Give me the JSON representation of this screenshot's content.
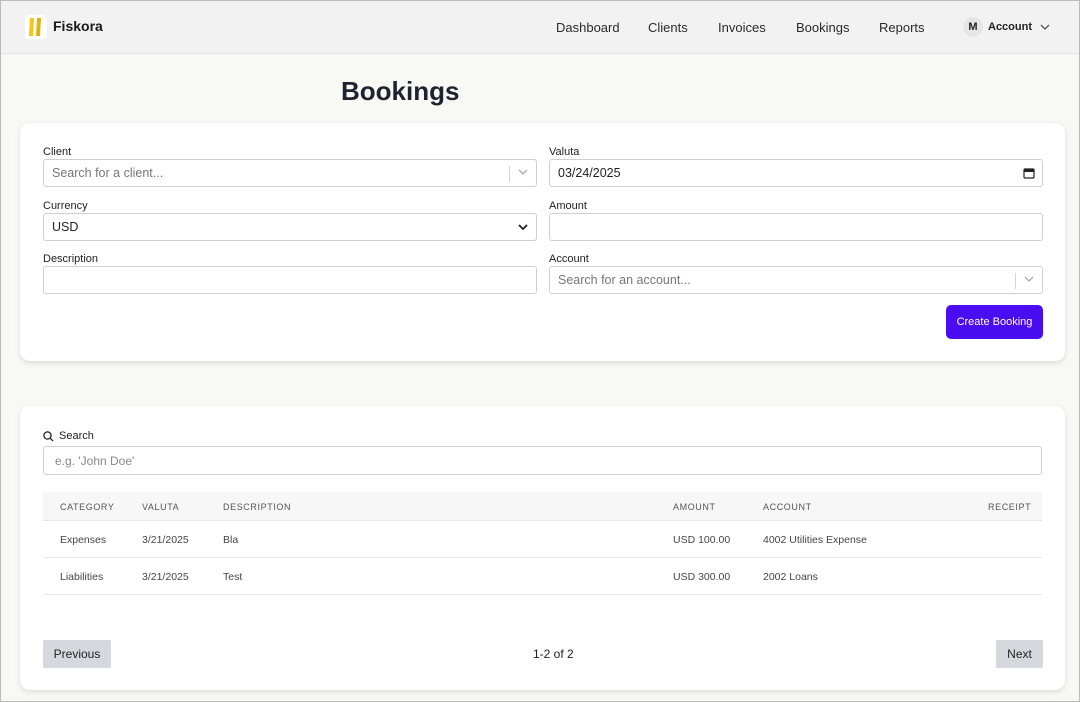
{
  "app": {
    "brand": "Fiskora"
  },
  "nav": {
    "items": [
      {
        "label": "Dashboard"
      },
      {
        "label": "Clients"
      },
      {
        "label": "Invoices"
      },
      {
        "label": "Bookings"
      },
      {
        "label": "Reports"
      }
    ],
    "account": {
      "initial": "M",
      "label": "Account"
    }
  },
  "page": {
    "title": "Bookings"
  },
  "form": {
    "client": {
      "label": "Client",
      "placeholder": "Search for a client..."
    },
    "valuta": {
      "label": "Valuta",
      "value": "03/24/2025"
    },
    "currency": {
      "label": "Currency",
      "value": "USD"
    },
    "amount": {
      "label": "Amount",
      "value": ""
    },
    "description": {
      "label": "Description",
      "value": ""
    },
    "account": {
      "label": "Account",
      "placeholder": "Search for an account..."
    },
    "submit_label": "Create Booking"
  },
  "list": {
    "search_label": "Search",
    "search_placeholder": "e.g. 'John Doe'",
    "columns": [
      "CATEGORY",
      "VALUTA",
      "DESCRIPTION",
      "AMOUNT",
      "ACCOUNT",
      "RECEIPT"
    ],
    "rows": [
      {
        "category": "Expenses",
        "valuta": "3/21/2025",
        "description": "Bla",
        "amount": "USD 100.00",
        "account": "4002 Utilities Expense",
        "receipt": ""
      },
      {
        "category": "Liabilities",
        "valuta": "3/21/2025",
        "description": "Test",
        "amount": "USD 300.00",
        "account": "2002 Loans",
        "receipt": ""
      }
    ],
    "pagination": {
      "prev_label": "Previous",
      "info": "1-2 of 2",
      "next_label": "Next"
    }
  },
  "colors": {
    "primary": "#4a0cf0",
    "logo_yellow": "#f5c518"
  }
}
